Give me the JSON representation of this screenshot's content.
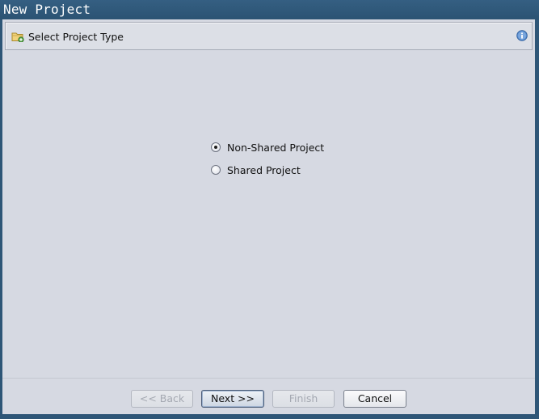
{
  "window": {
    "title": "New Project"
  },
  "header": {
    "title": "Select Project Type",
    "icon": "folder-add-icon",
    "info_icon": "info-icon"
  },
  "options": [
    {
      "label": "Non-Shared Project",
      "selected": true
    },
    {
      "label": "Shared Project",
      "selected": false
    }
  ],
  "buttons": {
    "back": {
      "label": "<< Back",
      "enabled": false
    },
    "next": {
      "label": "Next >>",
      "enabled": true
    },
    "finish": {
      "label": "Finish",
      "enabled": false
    },
    "cancel": {
      "label": "Cancel",
      "enabled": true
    }
  },
  "colors": {
    "titlebar": "#2e5677",
    "panel_background": "#d6d9e2",
    "info_icon": "#4a7fc1",
    "folder_icon": "#e8c45a"
  }
}
